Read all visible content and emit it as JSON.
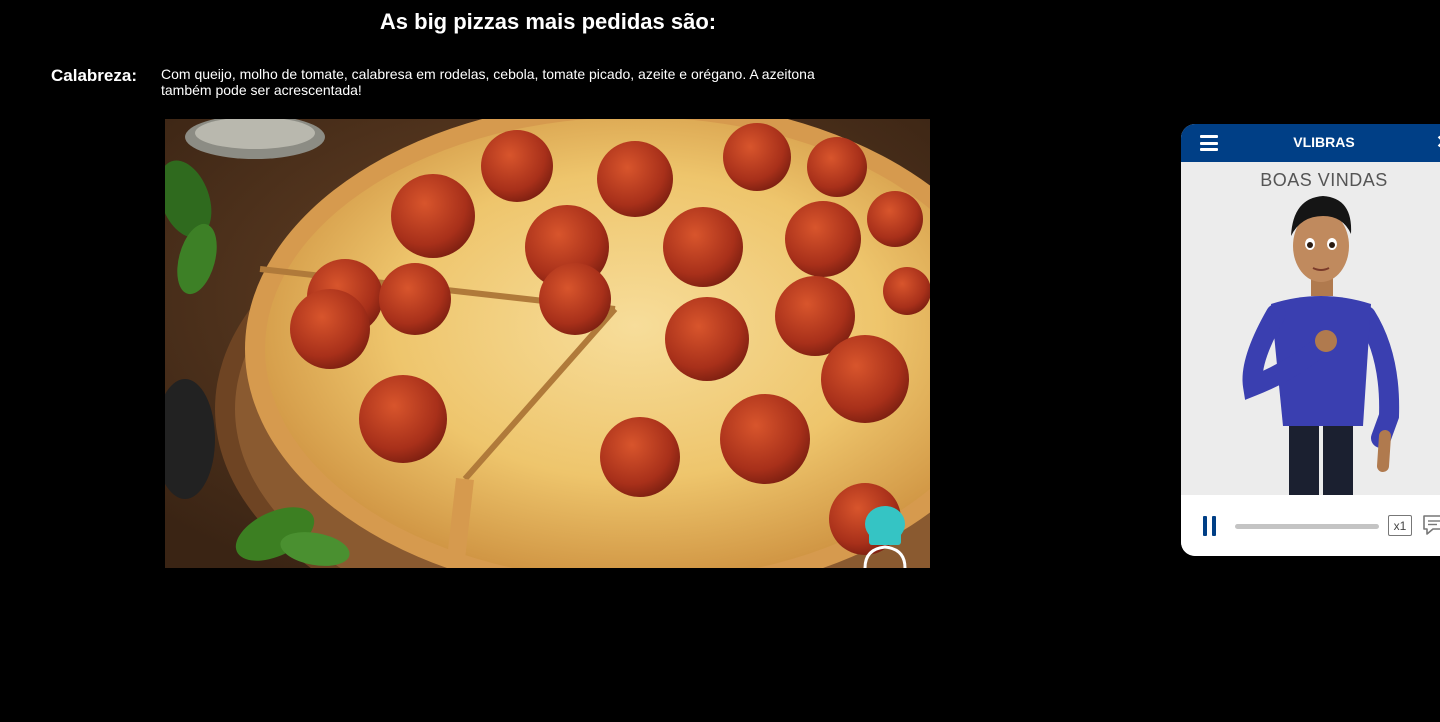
{
  "page": {
    "title": "As big pizzas mais pedidas são:",
    "items": [
      {
        "label": "Calabreza:",
        "description": "Com queijo, molho de tomate, calabresa em rodelas, cebola, tomate picado, azeite e orégano. A azeitona também pode ser acrescentada!"
      }
    ]
  },
  "image": {
    "subject": "pepperoni pizza on wooden board",
    "icon": "chef-hat-icon"
  },
  "vlibras": {
    "title": "VLIBRAS",
    "caption": "BOAS VINDAS",
    "speed": "x1",
    "progress": 1.0,
    "icons": [
      "menu-icon",
      "close-icon",
      "pause-icon",
      "subtitles-icon"
    ],
    "colors": {
      "header": "#003f86",
      "body": "#ececec"
    }
  },
  "colors": {
    "background": "#000000",
    "text": "#ffffff"
  }
}
